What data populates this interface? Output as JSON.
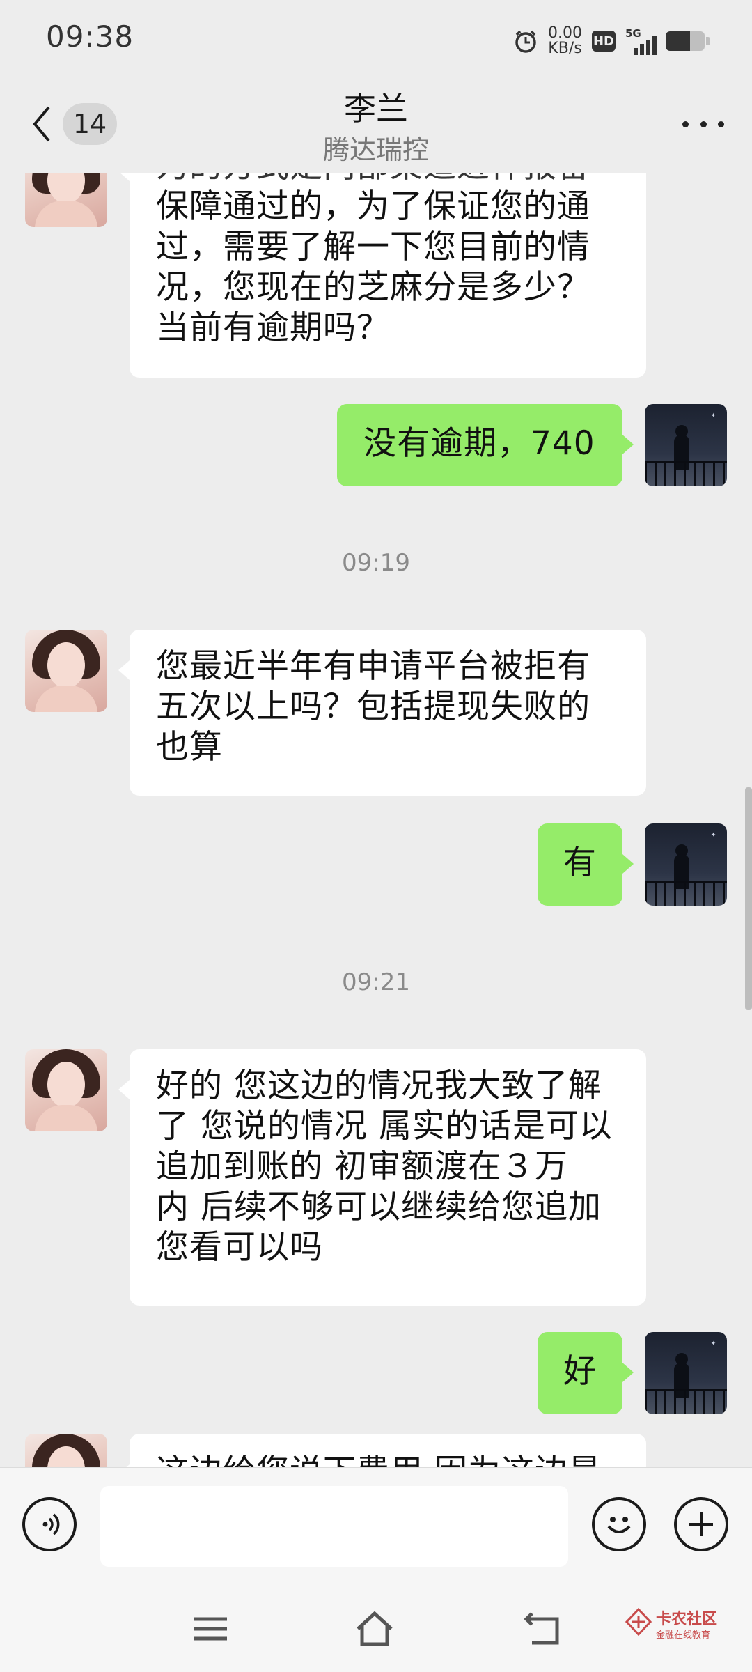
{
  "status_bar": {
    "time": "09:38",
    "net_speed_value": "0.00",
    "net_speed_unit": "KB/s",
    "hd_label": "HD",
    "network_label": "5G",
    "battery_level": 0.62,
    "icons": [
      "alarm-icon",
      "hd-icon",
      "signal-icon",
      "battery-icon"
    ]
  },
  "nav": {
    "unread_count": "14",
    "title": "李兰",
    "subtitle": "腾达瑞控",
    "icons": [
      "back-icon",
      "more-icon"
    ]
  },
  "messages": [
    {
      "side": "in",
      "lines": [
        "保障通过的，为了保证您的通",
        "过，需要了解一下您目前的情",
        "况，您现在的芝麻分是多少？",
        "当前有逾期吗？"
      ],
      "partial_top_line": "为的方式是内部渠道进件报备"
    },
    {
      "side": "out",
      "lines": [
        "没有逾期，740"
      ]
    },
    {
      "type": "time",
      "text": "09:19"
    },
    {
      "side": "in",
      "lines": [
        "您最近半年有申请平台被拒有",
        "五次以上吗？包括提现失败的",
        "也算"
      ]
    },
    {
      "side": "out",
      "lines": [
        "有"
      ]
    },
    {
      "type": "time",
      "text": "09:21"
    },
    {
      "side": "in",
      "lines": [
        "好的 您这边的情况我大致了解",
        "了 您说的情况 属实的话是可以",
        "追加到账的  初审额渡在３万",
        "内 后续不够可以继续给您追加",
        "您看可以吗"
      ]
    },
    {
      "side": "out",
      "lines": [
        "好"
      ]
    },
    {
      "side": "in",
      "partial_top_line": "这边给您说下费用 因为这边是"
    }
  ],
  "input": {
    "placeholder": "",
    "value": ""
  },
  "input_icons": [
    "voice-icon",
    "emoji-icon",
    "plus-icon"
  ],
  "system_nav": {
    "icons": [
      "menu-icon",
      "home-icon",
      "back-nav-icon"
    ]
  },
  "watermark": {
    "title": "卡农社区",
    "subtitle": "金融在线教育"
  },
  "colors": {
    "background": "#ededed",
    "outgoing_bubble": "#95ec69",
    "incoming_bubble": "#ffffff"
  }
}
